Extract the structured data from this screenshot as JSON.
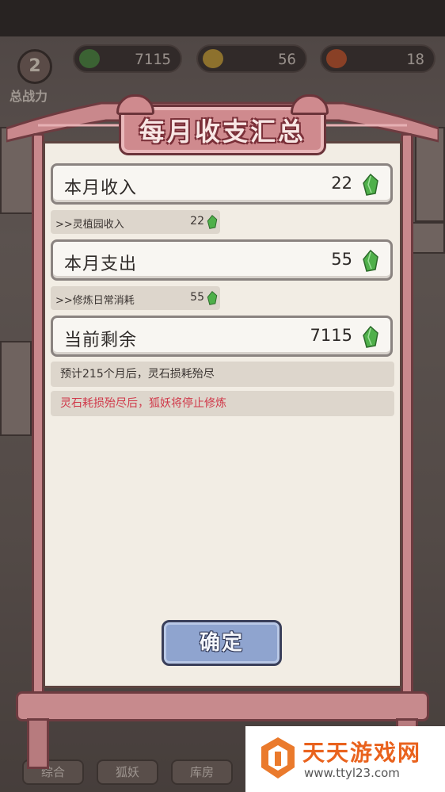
{
  "colors": {
    "panel_bg": "#f2ede4",
    "frame_pink": "#c9888c",
    "warning_text": "#d0394a",
    "gem_green": "#4fb04a",
    "confirm_button": "#8fa4cf"
  },
  "hud": {
    "resources": [
      {
        "name": "spirit-stone",
        "icon": "green-gem-icon",
        "value": "7115"
      },
      {
        "name": "gold",
        "icon": "gold-ingot-icon",
        "value": "56"
      },
      {
        "name": "fruit",
        "icon": "fruit-icon",
        "value": "18"
      }
    ],
    "power_level": "2",
    "power_label": "总战力"
  },
  "dialog": {
    "title": "每月收支汇总",
    "income": {
      "label": "本月收入",
      "value": "22"
    },
    "income_detail": {
      "label": ">>灵植园收入",
      "value": "22"
    },
    "expense": {
      "label": "本月支出",
      "value": "55"
    },
    "expense_detail": {
      "label": ">>修炼日常消耗",
      "value": "55"
    },
    "balance": {
      "label": "当前剩余",
      "value": "7115"
    },
    "forecast": "预计215个月后，灵石损耗殆尽",
    "warning": "灵石耗损殆尽后，狐妖将停止修炼",
    "confirm_label": "确定"
  },
  "bottom_nav": [
    "综合",
    "狐妖",
    "库房"
  ],
  "watermark": {
    "text": "天天游戏网",
    "url": "www.ttyl23.com"
  }
}
